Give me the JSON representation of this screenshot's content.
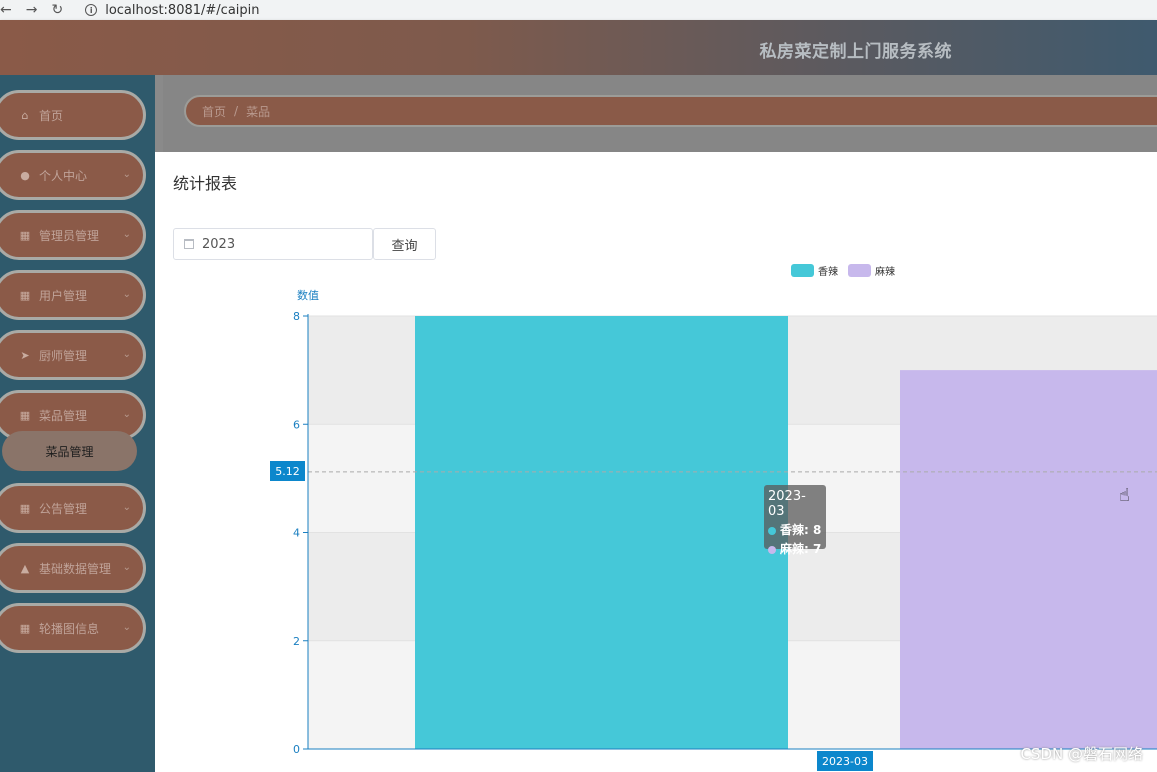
{
  "browser": {
    "back": "←",
    "forward": "→",
    "reload": "↻",
    "url": "localhost:8081/#/caipin"
  },
  "header": {
    "title": "私房菜定制上门服务系统"
  },
  "sidebar": {
    "items": [
      {
        "label": "首页",
        "icon": "home-icon",
        "glyph": "⌂"
      },
      {
        "label": "个人中心",
        "icon": "user-icon",
        "glyph": "●"
      },
      {
        "label": "管理员管理",
        "icon": "grid-icon",
        "glyph": "▦"
      },
      {
        "label": "用户管理",
        "icon": "grid-icon",
        "glyph": "▦"
      },
      {
        "label": "厨师管理",
        "icon": "send-icon",
        "glyph": "➤"
      },
      {
        "label": "菜品管理",
        "icon": "grid-icon",
        "glyph": "▦"
      },
      {
        "label": "公告管理",
        "icon": "grid-icon",
        "glyph": "▦"
      },
      {
        "label": "基础数据管理",
        "icon": "thumb-icon",
        "glyph": "▲"
      },
      {
        "label": "轮播图信息",
        "icon": "grid-icon",
        "glyph": "▦"
      }
    ],
    "submenu_label": "菜品管理"
  },
  "breadcrumb": {
    "home": "首页",
    "separator": "/",
    "current": "菜品"
  },
  "main": {
    "title": "统计报表",
    "year_value": "2023",
    "query_label": "查询"
  },
  "chart_data": {
    "type": "bar",
    "categories": [
      "2023-03"
    ],
    "series": [
      {
        "name": "香辣",
        "values": [
          8
        ],
        "color": "#45c8d8"
      },
      {
        "name": "麻辣",
        "values": [
          7
        ],
        "color": "#c7b8ec"
      }
    ],
    "ylabel": "数值",
    "ylim": [
      0,
      8
    ],
    "yticks": [
      0,
      2,
      4,
      6,
      8
    ],
    "legend_position": "top",
    "crosshair_value": "5.12",
    "tooltip": {
      "title": "2023-03",
      "rows": [
        "香辣: 8",
        "麻辣: 7"
      ]
    }
  },
  "watermark": "CSDN @磐石网络"
}
